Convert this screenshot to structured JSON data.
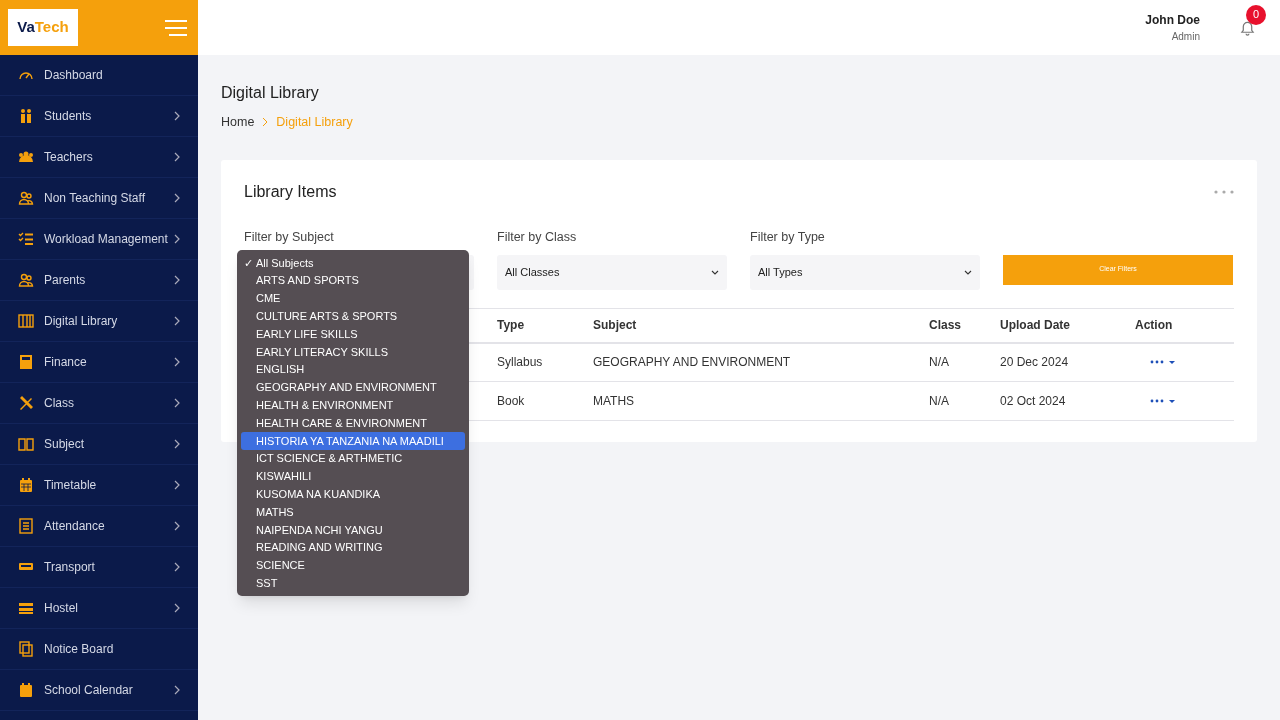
{
  "brand": {
    "logo_part1": "Va",
    "logo_part2": "Tech"
  },
  "sidebar": {
    "items": [
      {
        "label": "Dashboard",
        "expandable": false
      },
      {
        "label": "Students",
        "expandable": true
      },
      {
        "label": "Teachers",
        "expandable": true
      },
      {
        "label": "Non Teaching Staff",
        "expandable": true
      },
      {
        "label": "Workload Management",
        "expandable": true
      },
      {
        "label": "Parents",
        "expandable": true
      },
      {
        "label": "Digital Library",
        "expandable": true
      },
      {
        "label": "Finance",
        "expandable": true
      },
      {
        "label": "Class",
        "expandable": true
      },
      {
        "label": "Subject",
        "expandable": true
      },
      {
        "label": "Timetable",
        "expandable": true
      },
      {
        "label": "Attendance",
        "expandable": true
      },
      {
        "label": "Transport",
        "expandable": true
      },
      {
        "label": "Hostel",
        "expandable": true
      },
      {
        "label": "Notice Board",
        "expandable": false
      },
      {
        "label": "School Calendar",
        "expandable": true
      }
    ]
  },
  "user": {
    "name": "John Doe",
    "role": "Admin",
    "notifications": "0"
  },
  "page": {
    "title": "Digital Library",
    "breadcrumb": [
      {
        "label": "Home",
        "selected": false
      },
      {
        "label": "Digital Library",
        "selected": true
      }
    ]
  },
  "card": {
    "title": "Library Items",
    "filters": [
      {
        "label": "Filter by Subject"
      },
      {
        "label": "Filter by Class",
        "value": "All Classes"
      },
      {
        "label": "Filter by Type",
        "value": "All Types"
      }
    ],
    "clear_button": "Clear Filters",
    "table": {
      "columns": [
        "Type",
        "Subject",
        "Class",
        "Upload Date",
        "Action"
      ],
      "rows": [
        [
          "Syllabus",
          "GEOGRAPHY AND ENVIRONMENT",
          "N/A",
          "20 Dec 2024"
        ],
        [
          "Book",
          "MATHS",
          "N/A",
          "02 Oct 2024"
        ]
      ]
    }
  },
  "subject_dropdown": {
    "check_mark": "✓",
    "options": [
      {
        "label": "All Subjects",
        "selected": true,
        "highlighted": false
      },
      {
        "label": "ARTS AND SPORTS",
        "selected": false,
        "highlighted": false
      },
      {
        "label": "CME",
        "selected": false,
        "highlighted": false
      },
      {
        "label": "CULTURE ARTS & SPORTS",
        "selected": false,
        "highlighted": false
      },
      {
        "label": "EARLY LIFE SKILLS",
        "selected": false,
        "highlighted": false
      },
      {
        "label": "EARLY LITERACY SKILLS",
        "selected": false,
        "highlighted": false
      },
      {
        "label": "ENGLISH",
        "selected": false,
        "highlighted": false
      },
      {
        "label": "GEOGRAPHY AND ENVIRONMENT",
        "selected": false,
        "highlighted": false
      },
      {
        "label": "HEALTH & ENVIRONMENT",
        "selected": false,
        "highlighted": false
      },
      {
        "label": "HEALTH CARE & ENVIRONMENT",
        "selected": false,
        "highlighted": false
      },
      {
        "label": "HISTORIA YA TANZANIA NA MAADILI",
        "selected": false,
        "highlighted": true
      },
      {
        "label": "ICT SCIENCE & ARTHMETIC",
        "selected": false,
        "highlighted": false
      },
      {
        "label": "KISWAHILI",
        "selected": false,
        "highlighted": false
      },
      {
        "label": "KUSOMA NA KUANDIKA",
        "selected": false,
        "highlighted": false
      },
      {
        "label": "MATHS",
        "selected": false,
        "highlighted": false
      },
      {
        "label": "NAIPENDA NCHI YANGU",
        "selected": false,
        "highlighted": false
      },
      {
        "label": "READING AND WRITING",
        "selected": false,
        "highlighted": false
      },
      {
        "label": "SCIENCE",
        "selected": false,
        "highlighted": false
      },
      {
        "label": "SST",
        "selected": false,
        "highlighted": false
      }
    ]
  }
}
